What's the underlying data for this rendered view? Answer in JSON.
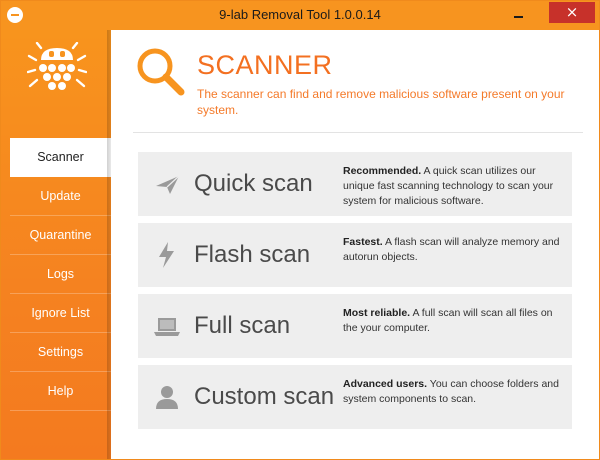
{
  "window": {
    "title": "9-lab Removal Tool 1.0.0.14",
    "close_glyph": "×"
  },
  "sidebar": {
    "items": [
      {
        "label": "Scanner",
        "active": true
      },
      {
        "label": "Update"
      },
      {
        "label": "Quarantine"
      },
      {
        "label": "Logs"
      },
      {
        "label": "Ignore List"
      },
      {
        "label": "Settings"
      },
      {
        "label": "Help"
      }
    ]
  },
  "header": {
    "title": "SCANNER",
    "subtitle": "The scanner can find and remove malicious software present on your system."
  },
  "scans": [
    {
      "name": "Quick scan",
      "icon": "paper-plane-icon",
      "bold": "Recommended.",
      "text": " A quick scan utilizes our unique fast scanning technology to scan your system for malicious software."
    },
    {
      "name": "Flash scan",
      "icon": "lightning-icon",
      "bold": "Fastest.",
      "text": " A flash scan will analyze memory and autorun objects."
    },
    {
      "name": "Full scan",
      "icon": "laptop-icon",
      "bold": "Most reliable.",
      "text": " A full scan will scan all files on the your computer."
    },
    {
      "name": "Custom scan",
      "icon": "user-icon",
      "bold": "Advanced users.",
      "text": " You can choose folders and system components to scan."
    }
  ],
  "colors": {
    "accent": "#f7941f",
    "title_orange": "#f37021",
    "close_red": "#c7312a",
    "card_bg": "#eeeeee"
  }
}
